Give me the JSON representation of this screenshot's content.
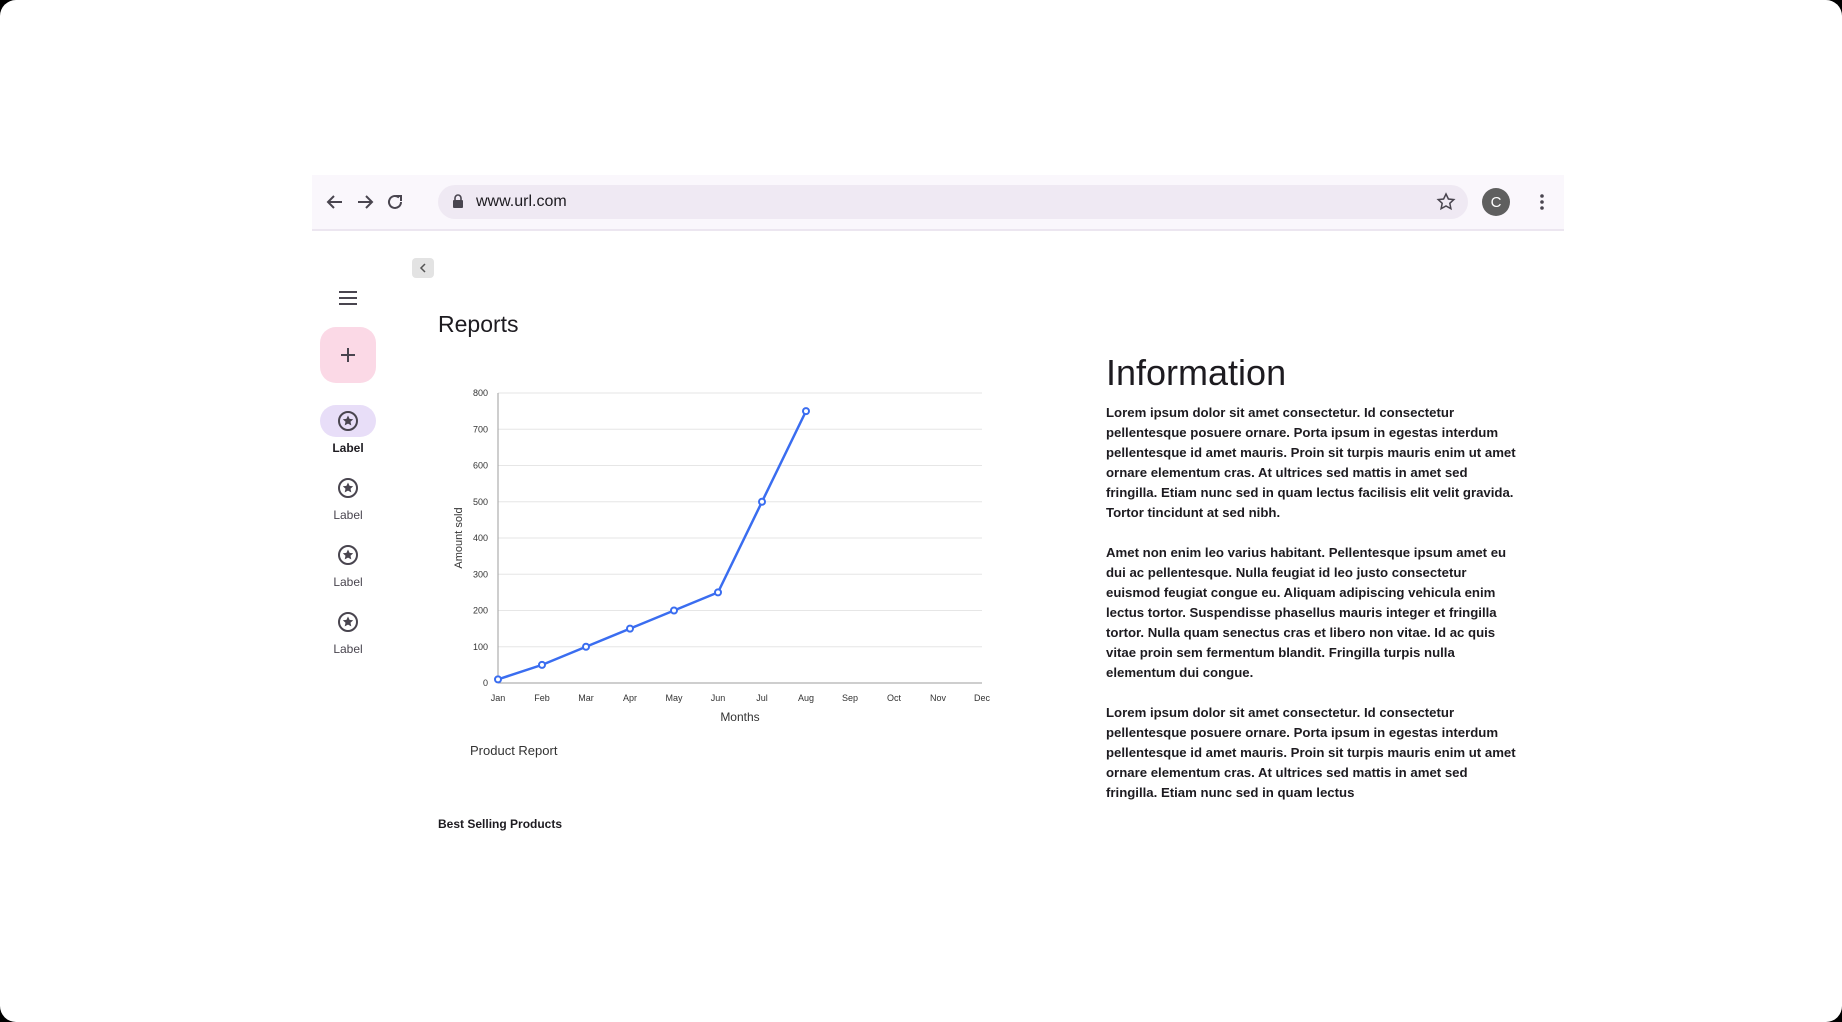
{
  "browser": {
    "url": "www.url.com",
    "avatar_letter": "C"
  },
  "rail": {
    "items": [
      {
        "label": "Label",
        "active": true
      },
      {
        "label": "Label",
        "active": false
      },
      {
        "label": "Label",
        "active": false
      },
      {
        "label": "Label",
        "active": false
      }
    ]
  },
  "main": {
    "title": "Reports",
    "chart_caption": "Product Report",
    "best_selling": "Best Selling Products"
  },
  "info": {
    "title": "Information",
    "paragraphs": [
      "Lorem ipsum dolor sit amet consectetur. Id consectetur pellentesque posuere ornare. Porta ipsum in egestas interdum pellentesque id amet mauris. Proin sit turpis mauris enim ut amet ornare elementum cras. At ultrices sed mattis in amet sed fringilla. Etiam nunc sed in quam lectus facilisis elit velit gravida. Tortor tincidunt at sed nibh.",
      "Amet non enim leo varius habitant. Pellentesque ipsum amet eu dui ac pellentesque. Nulla feugiat id leo justo consectetur euismod feugiat congue eu. Aliquam adipiscing vehicula enim lectus tortor. Suspendisse phasellus mauris integer et fringilla tortor. Nulla quam senectus cras et libero non vitae. Id ac quis vitae proin sem fermentum blandit. Fringilla turpis nulla elementum dui congue.",
      "Lorem ipsum dolor sit amet consectetur. Id consectetur pellentesque posuere ornare. Porta ipsum in egestas interdum pellentesque id amet mauris. Proin sit turpis mauris enim ut amet ornare elementum cras. At ultrices sed mattis in amet sed fringilla. Etiam nunc sed in quam lectus"
    ]
  },
  "chart_data": {
    "type": "line",
    "categories": [
      "Jan",
      "Feb",
      "Mar",
      "Apr",
      "May",
      "Jun",
      "Jul",
      "Aug",
      "Sep",
      "Oct",
      "Nov",
      "Dec"
    ],
    "series": [
      {
        "values": [
          10,
          50,
          100,
          150,
          200,
          250,
          500,
          750
        ]
      }
    ],
    "xlabel": "Months",
    "ylabel": "Amount sold",
    "ylim": [
      0,
      800
    ],
    "yticks": [
      0,
      100,
      200,
      300,
      400,
      500,
      600,
      700,
      800
    ],
    "grid": true,
    "color": "#3a6df0"
  }
}
